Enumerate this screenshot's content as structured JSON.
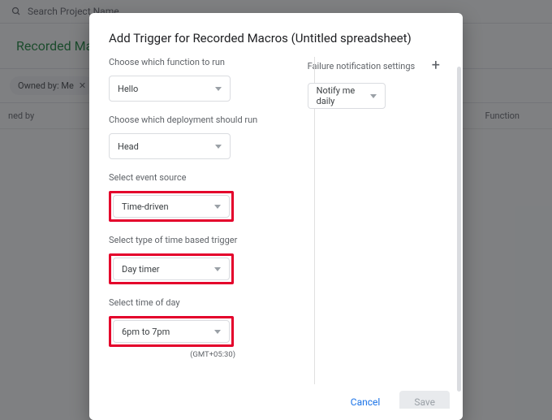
{
  "bg": {
    "search_placeholder": "Search Project Name",
    "title": "Recorded Mac",
    "chip_label": "Owned by: Me",
    "col_owned": "ned by",
    "col_function": "Function"
  },
  "dialog": {
    "title": "Add Trigger for Recorded Macros (Untitled spreadsheet)",
    "left": {
      "function_label": "Choose which function to run",
      "function_value": "Hello",
      "deployment_label": "Choose which deployment should run",
      "deployment_value": "Head",
      "source_label": "Select event source",
      "source_value": "Time-driven",
      "type_label": "Select type of time based trigger",
      "type_value": "Day timer",
      "time_label": "Select time of day",
      "time_value": "6pm to 7pm",
      "tz": "(GMT+05:30)"
    },
    "right": {
      "notify_label": "Failure notification settings",
      "notify_value": "Notify me daily"
    },
    "footer": {
      "cancel": "Cancel",
      "save": "Save"
    }
  }
}
